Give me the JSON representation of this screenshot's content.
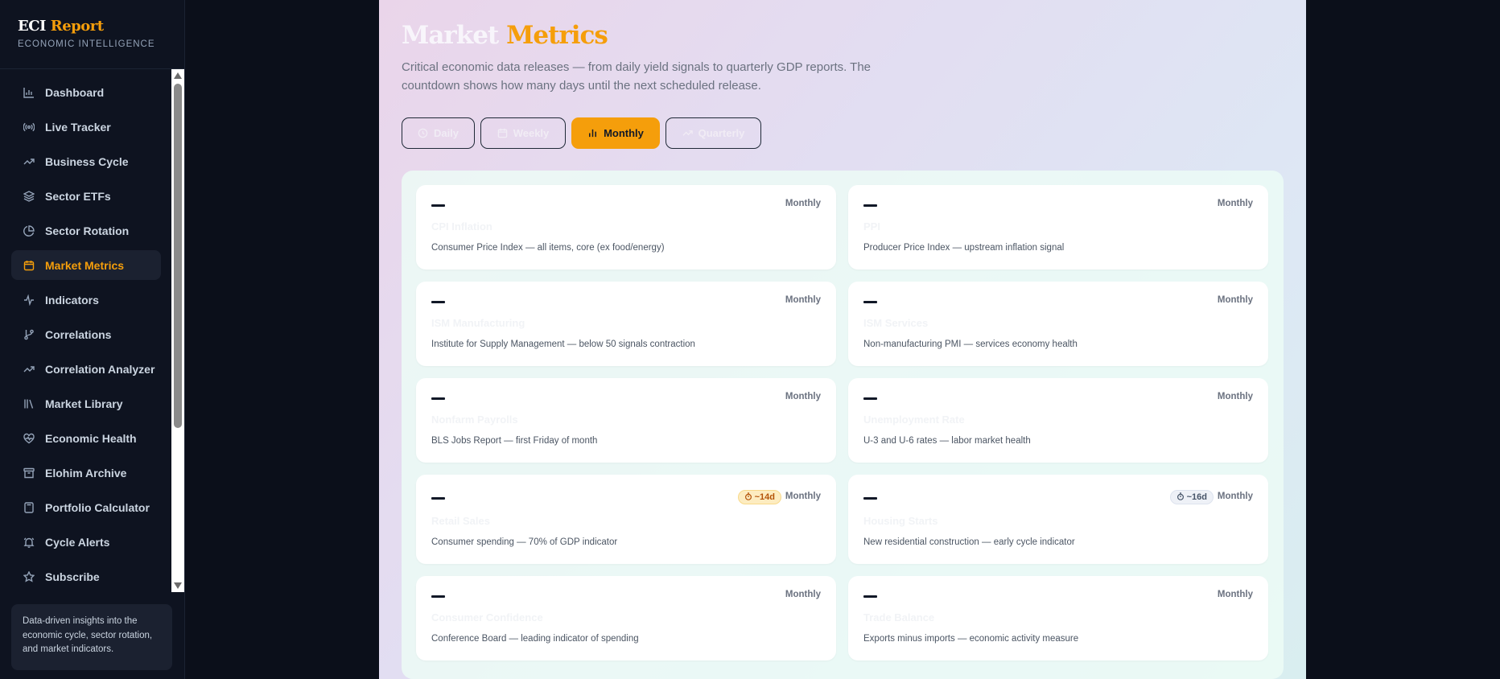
{
  "brand": {
    "title_main": "ECI",
    "title_accent": "Report",
    "subtitle": "ECONOMIC INTELLIGENCE"
  },
  "sidebar": {
    "items": [
      {
        "label": "Dashboard",
        "icon": "bar-chart-icon"
      },
      {
        "label": "Live Tracker",
        "icon": "radio-icon"
      },
      {
        "label": "Business Cycle",
        "icon": "trending-up-icon"
      },
      {
        "label": "Sector ETFs",
        "icon": "layers-icon"
      },
      {
        "label": "Sector Rotation",
        "icon": "pie-chart-icon"
      },
      {
        "label": "Market Metrics",
        "icon": "calendar-icon",
        "active": true
      },
      {
        "label": "Indicators",
        "icon": "activity-icon"
      },
      {
        "label": "Correlations",
        "icon": "git-branch-icon"
      },
      {
        "label": "Correlation Analyzer",
        "icon": "trending-up-icon"
      },
      {
        "label": "Market Library",
        "icon": "library-icon"
      },
      {
        "label": "Economic Health",
        "icon": "heart-pulse-icon"
      },
      {
        "label": "Elohim Archive",
        "icon": "archive-icon"
      },
      {
        "label": "Portfolio Calculator",
        "icon": "calculator-icon"
      },
      {
        "label": "Cycle Alerts",
        "icon": "bell-icon"
      },
      {
        "label": "Subscribe",
        "icon": "star-icon"
      }
    ],
    "footer": "Data-driven insights into the economic cycle, sector rotation, and market indicators."
  },
  "main": {
    "title_part1": "Market",
    "title_part2": "Metrics",
    "description": "Critical economic data releases — from daily yield signals to quarterly GDP reports. The countdown shows how many days until the next scheduled release.",
    "tabs": [
      {
        "label": "Daily",
        "icon": "clock-icon"
      },
      {
        "label": "Weekly",
        "icon": "calendar-icon"
      },
      {
        "label": "Monthly",
        "icon": "bar-chart-icon",
        "active": true
      },
      {
        "label": "Quarterly",
        "icon": "trending-up-icon"
      }
    ],
    "cards": [
      {
        "value": "—",
        "frequency": "Monthly",
        "name": "CPI Inflation",
        "description": "Consumer Price Index — all items, core (ex food/energy)"
      },
      {
        "value": "—",
        "frequency": "Monthly",
        "name": "PPI",
        "description": "Producer Price Index — upstream inflation signal"
      },
      {
        "value": "—",
        "frequency": "Monthly",
        "name": "ISM Manufacturing",
        "description": "Institute for Supply Management — below 50 signals contraction"
      },
      {
        "value": "—",
        "frequency": "Monthly",
        "name": "ISM Services",
        "description": "Non-manufacturing PMI — services economy health"
      },
      {
        "value": "—",
        "frequency": "Monthly",
        "name": "Nonfarm Payrolls",
        "description": "BLS Jobs Report — first Friday of month"
      },
      {
        "value": "—",
        "frequency": "Monthly",
        "name": "Unemployment Rate",
        "description": "U-3 and U-6 rates — labor market health"
      },
      {
        "value": "—",
        "frequency": "Monthly",
        "name": "Retail Sales",
        "description": "Consumer spending — 70% of GDP indicator",
        "countdown": "~14d",
        "countdown_style": "warn"
      },
      {
        "value": "—",
        "frequency": "Monthly",
        "name": "Housing Starts",
        "description": "New residential construction — early cycle indicator",
        "countdown": "~16d",
        "countdown_style": "neutral"
      },
      {
        "value": "—",
        "frequency": "Monthly",
        "name": "Consumer Confidence",
        "description": "Conference Board — leading indicator of spending"
      },
      {
        "value": "—",
        "frequency": "Monthly",
        "name": "Trade Balance",
        "description": "Exports minus imports — economic activity measure"
      }
    ]
  },
  "colors": {
    "accent": "#f59e0b",
    "sidebar_bg": "#0e1320",
    "page_bg": "#0b0f1a"
  }
}
